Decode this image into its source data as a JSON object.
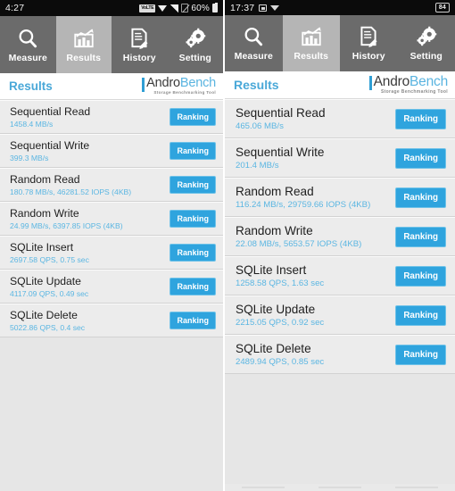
{
  "app": {
    "name": "AndroBench",
    "logo_primary": "Andro",
    "logo_secondary": "Bench",
    "logo_tagline": "Storage Benchmarking Tool"
  },
  "colors": {
    "accent": "#2fa4de",
    "title_blue": "#4aa8d8",
    "sub_blue": "#5bb6e2",
    "tabbar": "#6b6b6b",
    "tab_active": "#b5b5b5",
    "row_bg": "#ececec"
  },
  "tabs": [
    {
      "label": "Measure",
      "icon": "magnifier-icon",
      "active": false
    },
    {
      "label": "Results",
      "icon": "bar-chart-icon",
      "active": true
    },
    {
      "label": "History",
      "icon": "document-pen-icon",
      "active": false
    },
    {
      "label": "Setting",
      "icon": "gears-icon",
      "active": false
    }
  ],
  "ranking_label": "Ranking",
  "left": {
    "status": {
      "time": "4:27",
      "icons": [
        "volte-icon",
        "wifi-icon",
        "signal-icon",
        "sim-off-icon"
      ],
      "volte_text": "VoLTE",
      "battery_percent": "60%"
    },
    "header_title": "Results",
    "rows": [
      {
        "title": "Sequential Read",
        "value": "1458.4 MB/s"
      },
      {
        "title": "Sequential Write",
        "value": "399.3 MB/s"
      },
      {
        "title": "Random Read",
        "value": "180.78 MB/s, 46281.52 IOPS (4KB)"
      },
      {
        "title": "Random Write",
        "value": "24.99 MB/s, 6397.85 IOPS (4KB)"
      },
      {
        "title": "SQLite Insert",
        "value": "2697.58 QPS, 0.75 sec"
      },
      {
        "title": "SQLite Update",
        "value": "4117.09 QPS, 0.49 sec"
      },
      {
        "title": "SQLite Delete",
        "value": "5022.86 QPS, 0.4 sec"
      }
    ]
  },
  "right": {
    "status": {
      "time": "17:37",
      "icons": [
        "cast-icon",
        "wifi-icon"
      ],
      "battery_level": "84"
    },
    "header_title": "Results",
    "rows": [
      {
        "title": "Sequential Read",
        "value": "465.06 MB/s"
      },
      {
        "title": "Sequential Write",
        "value": "201.4 MB/s"
      },
      {
        "title": "Random Read",
        "value": "116.24 MB/s, 29759.66 IOPS (4KB)"
      },
      {
        "title": "Random Write",
        "value": "22.08 MB/s, 5653.57 IOPS (4KB)"
      },
      {
        "title": "SQLite Insert",
        "value": "1258.58 QPS, 1.63 sec"
      },
      {
        "title": "SQLite Update",
        "value": "2215.05 QPS, 0.92 sec"
      },
      {
        "title": "SQLite Delete",
        "value": "2489.94 QPS, 0.85 sec"
      }
    ]
  }
}
